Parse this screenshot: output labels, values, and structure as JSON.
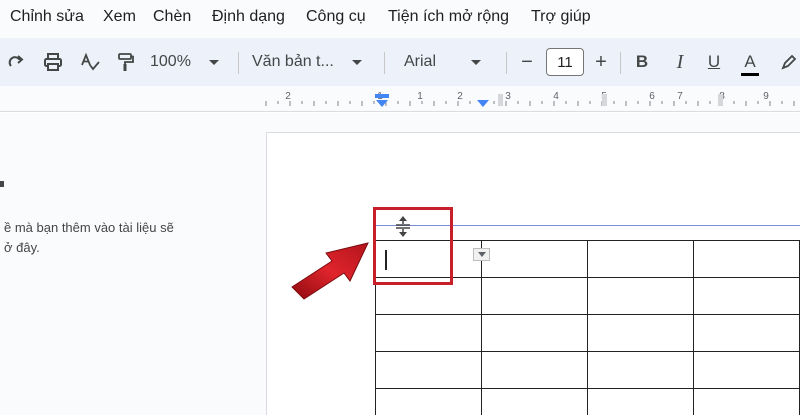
{
  "menu": {
    "items": [
      "Chỉnh sửa",
      "Xem",
      "Chèn",
      "Định dạng",
      "Công cụ",
      "Tiện ích mở rộng",
      "Trợ giúp"
    ]
  },
  "toolbar": {
    "zoom": "100%",
    "style": "Văn bản t...",
    "font": "Arial",
    "font_size": "11",
    "minus": "−",
    "plus": "+",
    "bold": "B",
    "italic": "I",
    "underline": "U",
    "text_color": "A",
    "text_color_value": "#000000"
  },
  "ruler": {
    "labels": [
      "2",
      "1",
      "1",
      "2",
      "3",
      "4",
      "5",
      "6",
      "7",
      "8",
      "9"
    ],
    "marker_color": "#4285f4"
  },
  "outline": {
    "text_line1": "ề mà bạn thêm vào tài liệu sẽ",
    "text_line2": "ở đây."
  },
  "document": {
    "table": {
      "rows": 5,
      "cols": 4
    },
    "annotation_color": "#c8202a"
  }
}
